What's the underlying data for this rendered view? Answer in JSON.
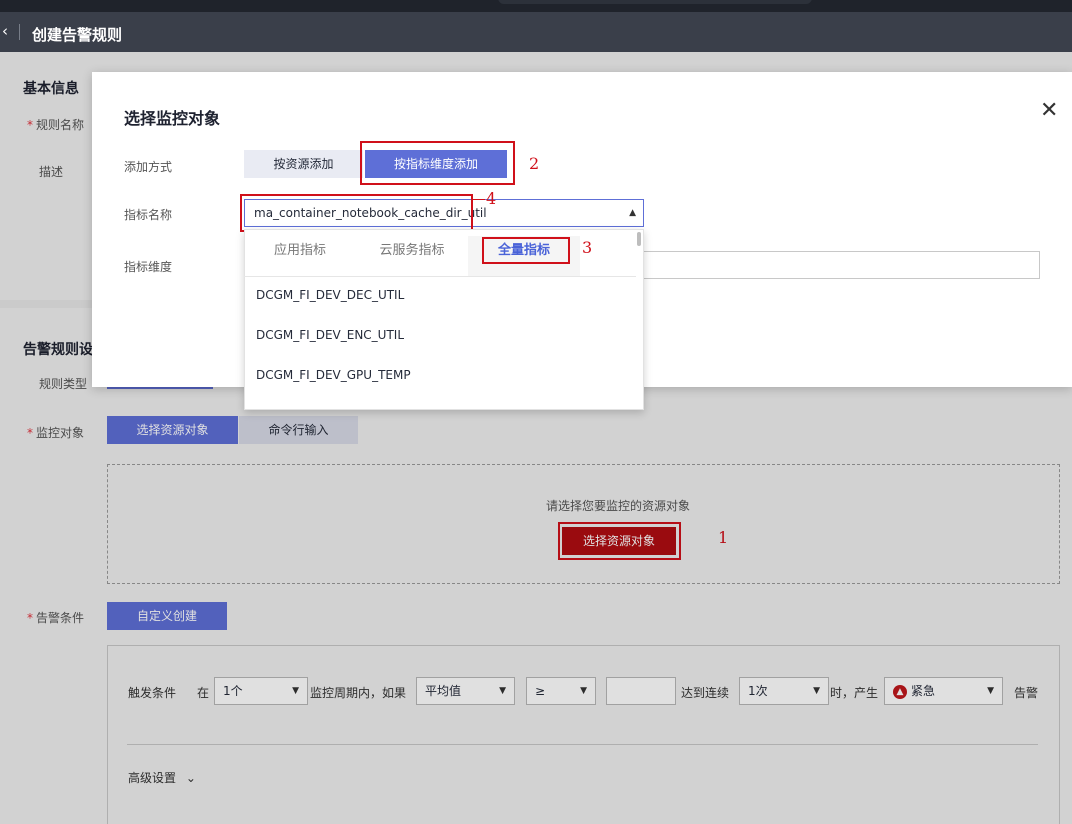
{
  "header": {
    "back_icon": "chevron-left-icon",
    "title": "创建告警规则"
  },
  "basic": {
    "section_title": "基本信息",
    "rule_name_label": "规则名称",
    "desc_label": "描述"
  },
  "rules": {
    "section_title": "告警规则设",
    "rule_type_label": "规则类型",
    "monitor_target_label": "监控对象",
    "tab_select_resource": "选择资源对象",
    "tab_cmdline": "命令行输入",
    "hint": "请选择您要监控的资源对象",
    "select_resource_btn": "选择资源对象",
    "alarm_cond_label": "告警条件",
    "custom_create": "自定义创建"
  },
  "condition": {
    "trigger_label": "触发条件",
    "at": "在",
    "period_value": "1个",
    "period_text": "监控周期内，如果",
    "agg_value": "平均值",
    "op_value": "≥",
    "threshold_value": "",
    "reach_text": "达到连续",
    "times_value": "1次",
    "then_text": "时，产生",
    "severity_value": "紧急",
    "alarm_text": "告警",
    "advanced": "高级设置"
  },
  "modal": {
    "title": "选择监控对象",
    "add_method_label": "添加方式",
    "btn_by_resource": "按资源添加",
    "btn_by_metric": "按指标维度添加",
    "metric_name_label": "指标名称",
    "metric_value": "ma_container_notebook_cache_dir_util",
    "metric_dim_label": "指标维度"
  },
  "dropdown": {
    "tabs": [
      "应用指标",
      "云服务指标",
      "全量指标"
    ],
    "items": [
      "DCGM_FI_DEV_DEC_UTIL",
      "DCGM_FI_DEV_ENC_UTIL",
      "DCGM_FI_DEV_GPU_TEMP"
    ]
  },
  "annotations": [
    "1",
    "2",
    "3",
    "4"
  ],
  "colors": {
    "accent": "#5e6fd7",
    "danger": "#b00d12",
    "annotation": "#d0101a"
  }
}
